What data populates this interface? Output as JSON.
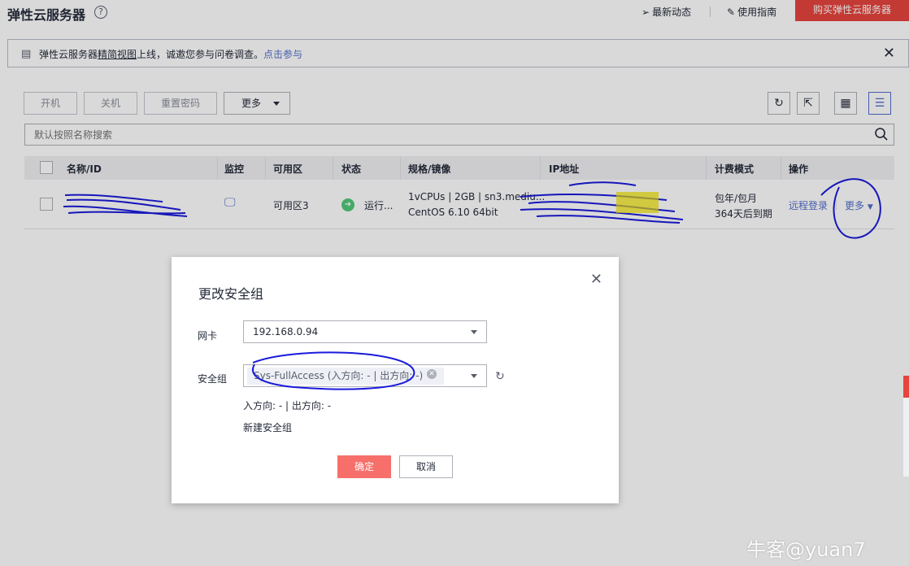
{
  "header": {
    "title": "弹性云服务器",
    "help": "?",
    "news_label": "最新动态",
    "guide_label": "使用指南",
    "buy_label": "购买弹性云服务器"
  },
  "notice": {
    "prefix": "弹性云服务器",
    "underlined": "精简视图",
    "suffix": "上线，诚邀您参与问卷调查。",
    "link": "点击参与"
  },
  "toolbar": {
    "start": "开机",
    "stop": "关机",
    "reset_password": "重置密码",
    "more": "更多"
  },
  "search": {
    "placeholder": "默认按照名称搜索"
  },
  "table": {
    "headers": {
      "name": "名称/ID",
      "monitor": "监控",
      "az": "可用区",
      "status": "状态",
      "spec": "规格/镜像",
      "ip": "IP地址",
      "billing": "计费模式",
      "ops": "操作"
    },
    "row": {
      "az": "可用区3",
      "status": "运行...",
      "spec_line1": "1vCPUs | 2GB | sn3.mediu...",
      "spec_line2": "CentOS 6.10 64bit",
      "billing_line1": "包年/包月",
      "billing_line2": "364天后到期",
      "remote_login": "远程登录",
      "more": "更多"
    }
  },
  "dialog": {
    "title": "更改安全组",
    "nic_label": "网卡",
    "nic_value": "192.168.0.94",
    "sg_label": "安全组",
    "sg_tag": "Sys-FullAccess (入方向: - | 出方向: -)",
    "rules_text": "入方向: - | 出方向: -",
    "create_link": "新建安全组",
    "ok": "确定",
    "cancel": "取消"
  },
  "watermark": "牛客@yuan7",
  "colors": {
    "brand_red": "#e6443d",
    "link_blue": "#526ecc",
    "ok_button": "#f66f6a",
    "running_green": "#50c878"
  }
}
